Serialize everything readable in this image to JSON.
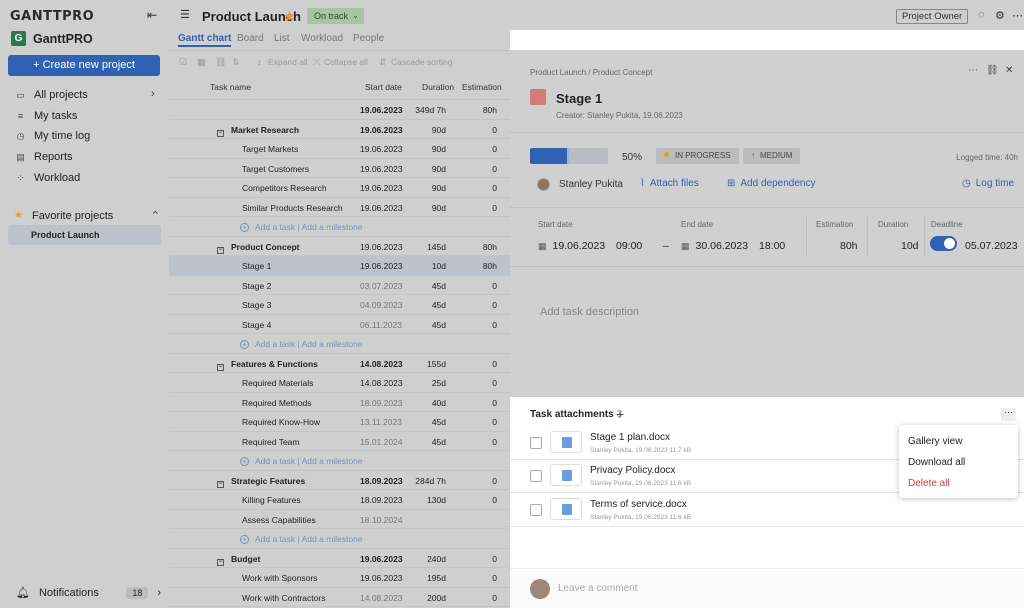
{
  "sidebar": {
    "logo": "GANTTPRO",
    "workspace": "GanttPRO",
    "create_button": "+ Create new project",
    "nav": [
      {
        "label": "All projects",
        "icon": "folder-icon"
      },
      {
        "label": "My tasks",
        "icon": "list-icon"
      },
      {
        "label": "My time log",
        "icon": "clock-icon"
      },
      {
        "label": "Reports",
        "icon": "report-icon"
      },
      {
        "label": "Workload",
        "icon": "workload-icon"
      }
    ],
    "favorites_label": "Favorite projects",
    "favorite_item": "Product Launch",
    "notifications_label": "Notifications",
    "notifications_count": "18"
  },
  "header": {
    "project_title": "Product Launch",
    "status": "On track",
    "role_button": "Project Owner"
  },
  "tabs": [
    "Gantt chart",
    "Board",
    "List",
    "Workload",
    "People"
  ],
  "toolbar": {
    "expand_all": "Expand all",
    "collapse_all": "Collapse all",
    "cascade_sorting": "Cascade sorting"
  },
  "grid": {
    "columns": {
      "task_name": "Task name",
      "start": "Start date",
      "duration": "Duration",
      "estimation": "Estimation"
    },
    "add_task": "Add a task",
    "add_milestone": "Add a milestone",
    "rows": [
      {
        "name": "",
        "start": "19.06.2023",
        "dur": "349d 7h",
        "est": "80h"
      },
      {
        "name": "Market Research",
        "start": "19.06.2023",
        "dur": "90d",
        "est": "0"
      },
      {
        "name": "Target Markets",
        "start": "19.06.2023",
        "dur": "90d",
        "est": "0"
      },
      {
        "name": "Target Customers",
        "start": "19.06.2023",
        "dur": "90d",
        "est": "0"
      },
      {
        "name": "Competitors Research",
        "start": "19.06.2023",
        "dur": "90d",
        "est": "0"
      },
      {
        "name": "Similar Products Research",
        "start": "19.06.2023",
        "dur": "90d",
        "est": "0"
      },
      {
        "name": "Product Concept",
        "start": "19.06.2023",
        "dur": "145d",
        "est": "80h"
      },
      {
        "name": "Stage 1",
        "start": "19.06.2023",
        "dur": "10d",
        "est": "80h"
      },
      {
        "name": "Stage 2",
        "start": "03.07.2023",
        "dur": "45d",
        "est": "0"
      },
      {
        "name": "Stage 3",
        "start": "04.09.2023",
        "dur": "45d",
        "est": "0"
      },
      {
        "name": "Stage 4",
        "start": "06.11.2023",
        "dur": "45d",
        "est": "0"
      },
      {
        "name": "Features & Functions",
        "start": "14.08.2023",
        "dur": "155d",
        "est": "0"
      },
      {
        "name": "Required Materials",
        "start": "14.08.2023",
        "dur": "25d",
        "est": "0"
      },
      {
        "name": "Required Methods",
        "start": "18.09.2023",
        "dur": "40d",
        "est": "0"
      },
      {
        "name": "Required Know-How",
        "start": "13.11.2023",
        "dur": "45d",
        "est": "0"
      },
      {
        "name": "Required Team",
        "start": "15.01.2024",
        "dur": "45d",
        "est": "0"
      },
      {
        "name": "Strategic Features",
        "start": "18.09.2023",
        "dur": "284d 7h",
        "est": "0"
      },
      {
        "name": "Killing Features",
        "start": "18.09.2023",
        "dur": "130d",
        "est": "0"
      },
      {
        "name": "Assess Capabilities",
        "start": "18.10.2024",
        "dur": "",
        "est": ""
      },
      {
        "name": "Budget",
        "start": "19.06.2023",
        "dur": "240d",
        "est": "0"
      },
      {
        "name": "Work with Sponsors",
        "start": "19.06.2023",
        "dur": "195d",
        "est": "0"
      },
      {
        "name": "Work with Contractors",
        "start": "14.08.2023",
        "dur": "200d",
        "est": "0"
      }
    ]
  },
  "detail": {
    "breadcrumb": "Product Launch / Product Concept",
    "title": "Stage 1",
    "creator": "Creator: Stanley Pukita, 19.06.2023",
    "progress_pct": "50%",
    "progress_value": 0.5,
    "status": "IN PROGRESS",
    "priority": "MEDIUM",
    "logged_time": "Logged time: 40h",
    "assignee": "Stanley Pukita",
    "attach_files": "Attach files",
    "add_dependency": "Add dependency",
    "log_time": "Log time",
    "start_date_label": "Start date",
    "start_date": "19.06.2023",
    "start_time": "09:00",
    "end_date_label": "End date",
    "end_date": "30.06.2023",
    "end_time": "18:00",
    "estimation_label": "Estimation",
    "estimation": "80h",
    "duration_label": "Duration",
    "duration": "10d",
    "deadline_label": "Deadline",
    "deadline": "05.07.2023",
    "description_placeholder": "Add task description"
  },
  "attachments": {
    "title": "Task attachments",
    "count": "3",
    "files": [
      {
        "name": "Stage 1 plan.docx",
        "meta": "Stanley Pukita,  19.06.2023     11.7 kB"
      },
      {
        "name": "Privacy Policy.docx",
        "meta": "Stanley Pukita,  19.06.2023     11.6 kB"
      },
      {
        "name": "Terms of service.docx",
        "meta": "Stanley Pukita,  19.06.2023     11.6 kB"
      }
    ],
    "menu": [
      "Gallery view",
      "Download all",
      "Delete all"
    ],
    "comment_placeholder": "Leave a comment"
  }
}
